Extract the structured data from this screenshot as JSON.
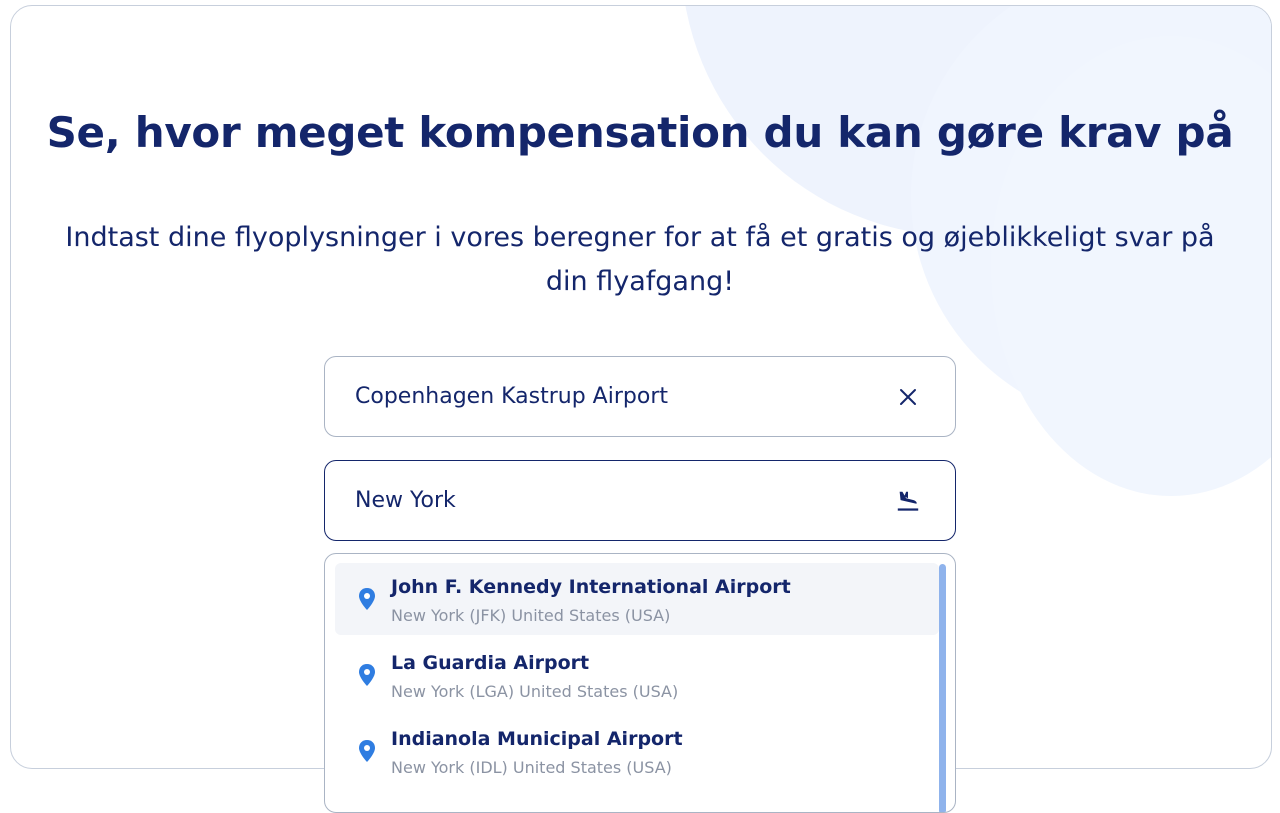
{
  "header": {
    "title": "Se, hvor meget kompensation du kan gøre krav på",
    "subtitle": "Indtast dine flyoplysninger i vores beregner for at få et gratis og øjeblikkeligt svar på din flyafgang!"
  },
  "form": {
    "departure": {
      "value": "Copenhagen Kastrup Airport",
      "icon": "close-icon"
    },
    "arrival": {
      "value": "New York",
      "icon": "plane-landing-icon"
    }
  },
  "suggestions": [
    {
      "name": "John F. Kennedy International Airport",
      "detail": "New York (JFK) United States (USA)",
      "icon": "location-pin-icon"
    },
    {
      "name": "La Guardia Airport",
      "detail": "New York (LGA) United States (USA)",
      "icon": "location-pin-icon"
    },
    {
      "name": "Indianola Municipal Airport",
      "detail": "New York (IDL) United States (USA)",
      "icon": "location-pin-icon"
    }
  ],
  "colors": {
    "primary_text": "#14266b",
    "muted_text": "#8b93a3",
    "pin": "#2f7de1",
    "scrollbar": "#8fb3ec",
    "background_blob": "#eef3fd"
  }
}
